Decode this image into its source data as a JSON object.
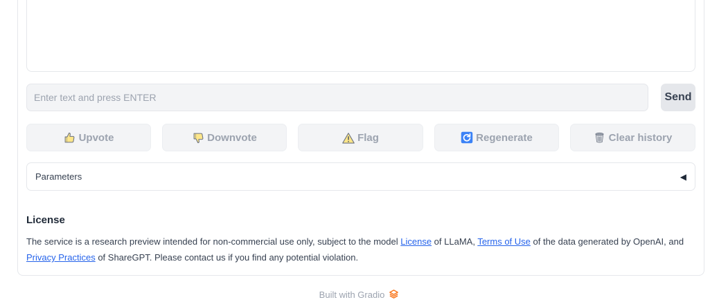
{
  "input": {
    "placeholder": "Enter text and press ENTER",
    "value": ""
  },
  "send_button": {
    "label": "Send"
  },
  "actions": {
    "upvote": {
      "label": "Upvote",
      "icon": "thumbs-up-icon"
    },
    "downvote": {
      "label": "Downvote",
      "icon": "thumbs-down-icon"
    },
    "flag": {
      "label": "Flag",
      "icon": "warning-icon"
    },
    "regenerate": {
      "label": "Regenerate",
      "icon": "refresh-icon"
    },
    "clear_history": {
      "label": "Clear history",
      "icon": "trash-icon"
    }
  },
  "parameters": {
    "label": "Parameters",
    "icon": "collapse-arrow-icon",
    "arrow": "◀"
  },
  "license": {
    "heading": "License",
    "text_1": "The service is a research preview intended for non-commercial use only, subject to the model ",
    "link_license": "License",
    "text_2": " of LLaMA, ",
    "link_terms": "Terms of Use",
    "text_3": " of the data generated by OpenAI, and ",
    "link_privacy": "Privacy Practices",
    "text_4": " of ShareGPT. Please contact us if you find any potential violation."
  },
  "footer": {
    "text": "Built with Gradio",
    "icon": "gradio-logo-icon"
  },
  "colors": {
    "link": "#2563eb",
    "gradio_orange": "#f97316",
    "disabled_text": "#9ca3af",
    "border": "#e5e7eb"
  }
}
